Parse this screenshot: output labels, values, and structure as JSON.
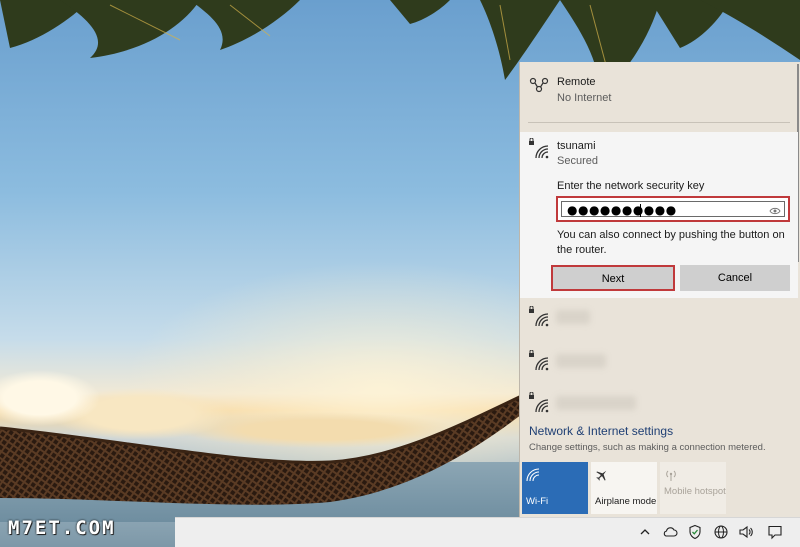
{
  "watermark": "M7ET.COM",
  "flyout": {
    "remote": {
      "name": "Remote",
      "status": "No Internet",
      "icon": "remote-network-icon"
    },
    "selected_network": {
      "name": "tsunami",
      "status": "Secured",
      "icon": "wifi-secured-icon",
      "key_label": "Enter the network security key",
      "key_value": "●●●●●●●●●●",
      "hint": "You can also connect by pushing the button on the router.",
      "next_label": "Next",
      "cancel_label": "Cancel"
    },
    "other_networks": [
      {
        "icon": "wifi-secured-icon"
      },
      {
        "icon": "wifi-secured-icon"
      },
      {
        "icon": "wifi-secured-icon"
      }
    ],
    "settings_link": "Network & Internet settings",
    "settings_desc": "Change settings, such as making a connection metered.",
    "tiles": {
      "wifi": {
        "label": "Wi-Fi",
        "icon": "wifi-icon",
        "active": true
      },
      "airplane": {
        "label": "Airplane mode",
        "icon": "airplane-icon",
        "active": false
      },
      "hotspot": {
        "label": "Mobile hotspot",
        "icon": "hotspot-icon",
        "disabled": true
      }
    }
  },
  "colors": {
    "accent": "#2b6cb6",
    "highlight_border": "#c0393b",
    "flyout_bg": "#e9e3d9"
  },
  "taskbar": {
    "tray_icons": [
      "chevron-up-icon",
      "cloud-icon",
      "security-shield-icon",
      "globe-network-icon",
      "volume-icon",
      "notification-icon"
    ]
  }
}
